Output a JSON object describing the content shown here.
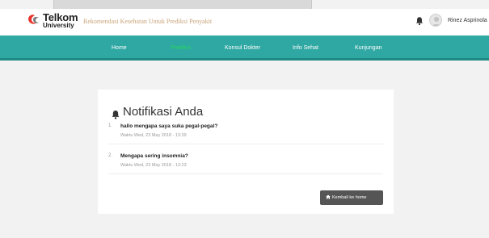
{
  "header": {
    "brand": "Telkom",
    "brand_sub": "University",
    "site_title": "Rekomendasi Kesehatan Untuk Prediksi Penyakit",
    "username": "Rinez Asprinola"
  },
  "nav": {
    "items": [
      {
        "label": "Home",
        "active": false
      },
      {
        "label": "Prediksi",
        "active": true
      },
      {
        "label": "Konsul Dokter",
        "active": false
      },
      {
        "label": "Info Sehat",
        "active": false
      },
      {
        "label": "Kunjungan",
        "active": false
      }
    ]
  },
  "notifications": {
    "title": "Notifikasi Anda",
    "items": [
      {
        "number": "1.",
        "question": "hallo mengapa saya suka pegal-pegal?",
        "time": "Waktu Wed, 23 May 2018 - 13:39"
      },
      {
        "number": "2.",
        "question": "Mengapa sering insomnia?",
        "time": "Waktu Wed, 23 May 2018 - 13:23"
      }
    ],
    "back_button": "Kembali ke home"
  },
  "colors": {
    "nav_bg": "#2fa8a3",
    "nav_active": "#27d65b",
    "title_text": "#c9a37a",
    "button_bg": "#555555"
  },
  "icons": {
    "logo": "telkom-logo-icon",
    "notification": "bell-icon",
    "avatar": "user-avatar-icon",
    "button": "home-icon"
  }
}
